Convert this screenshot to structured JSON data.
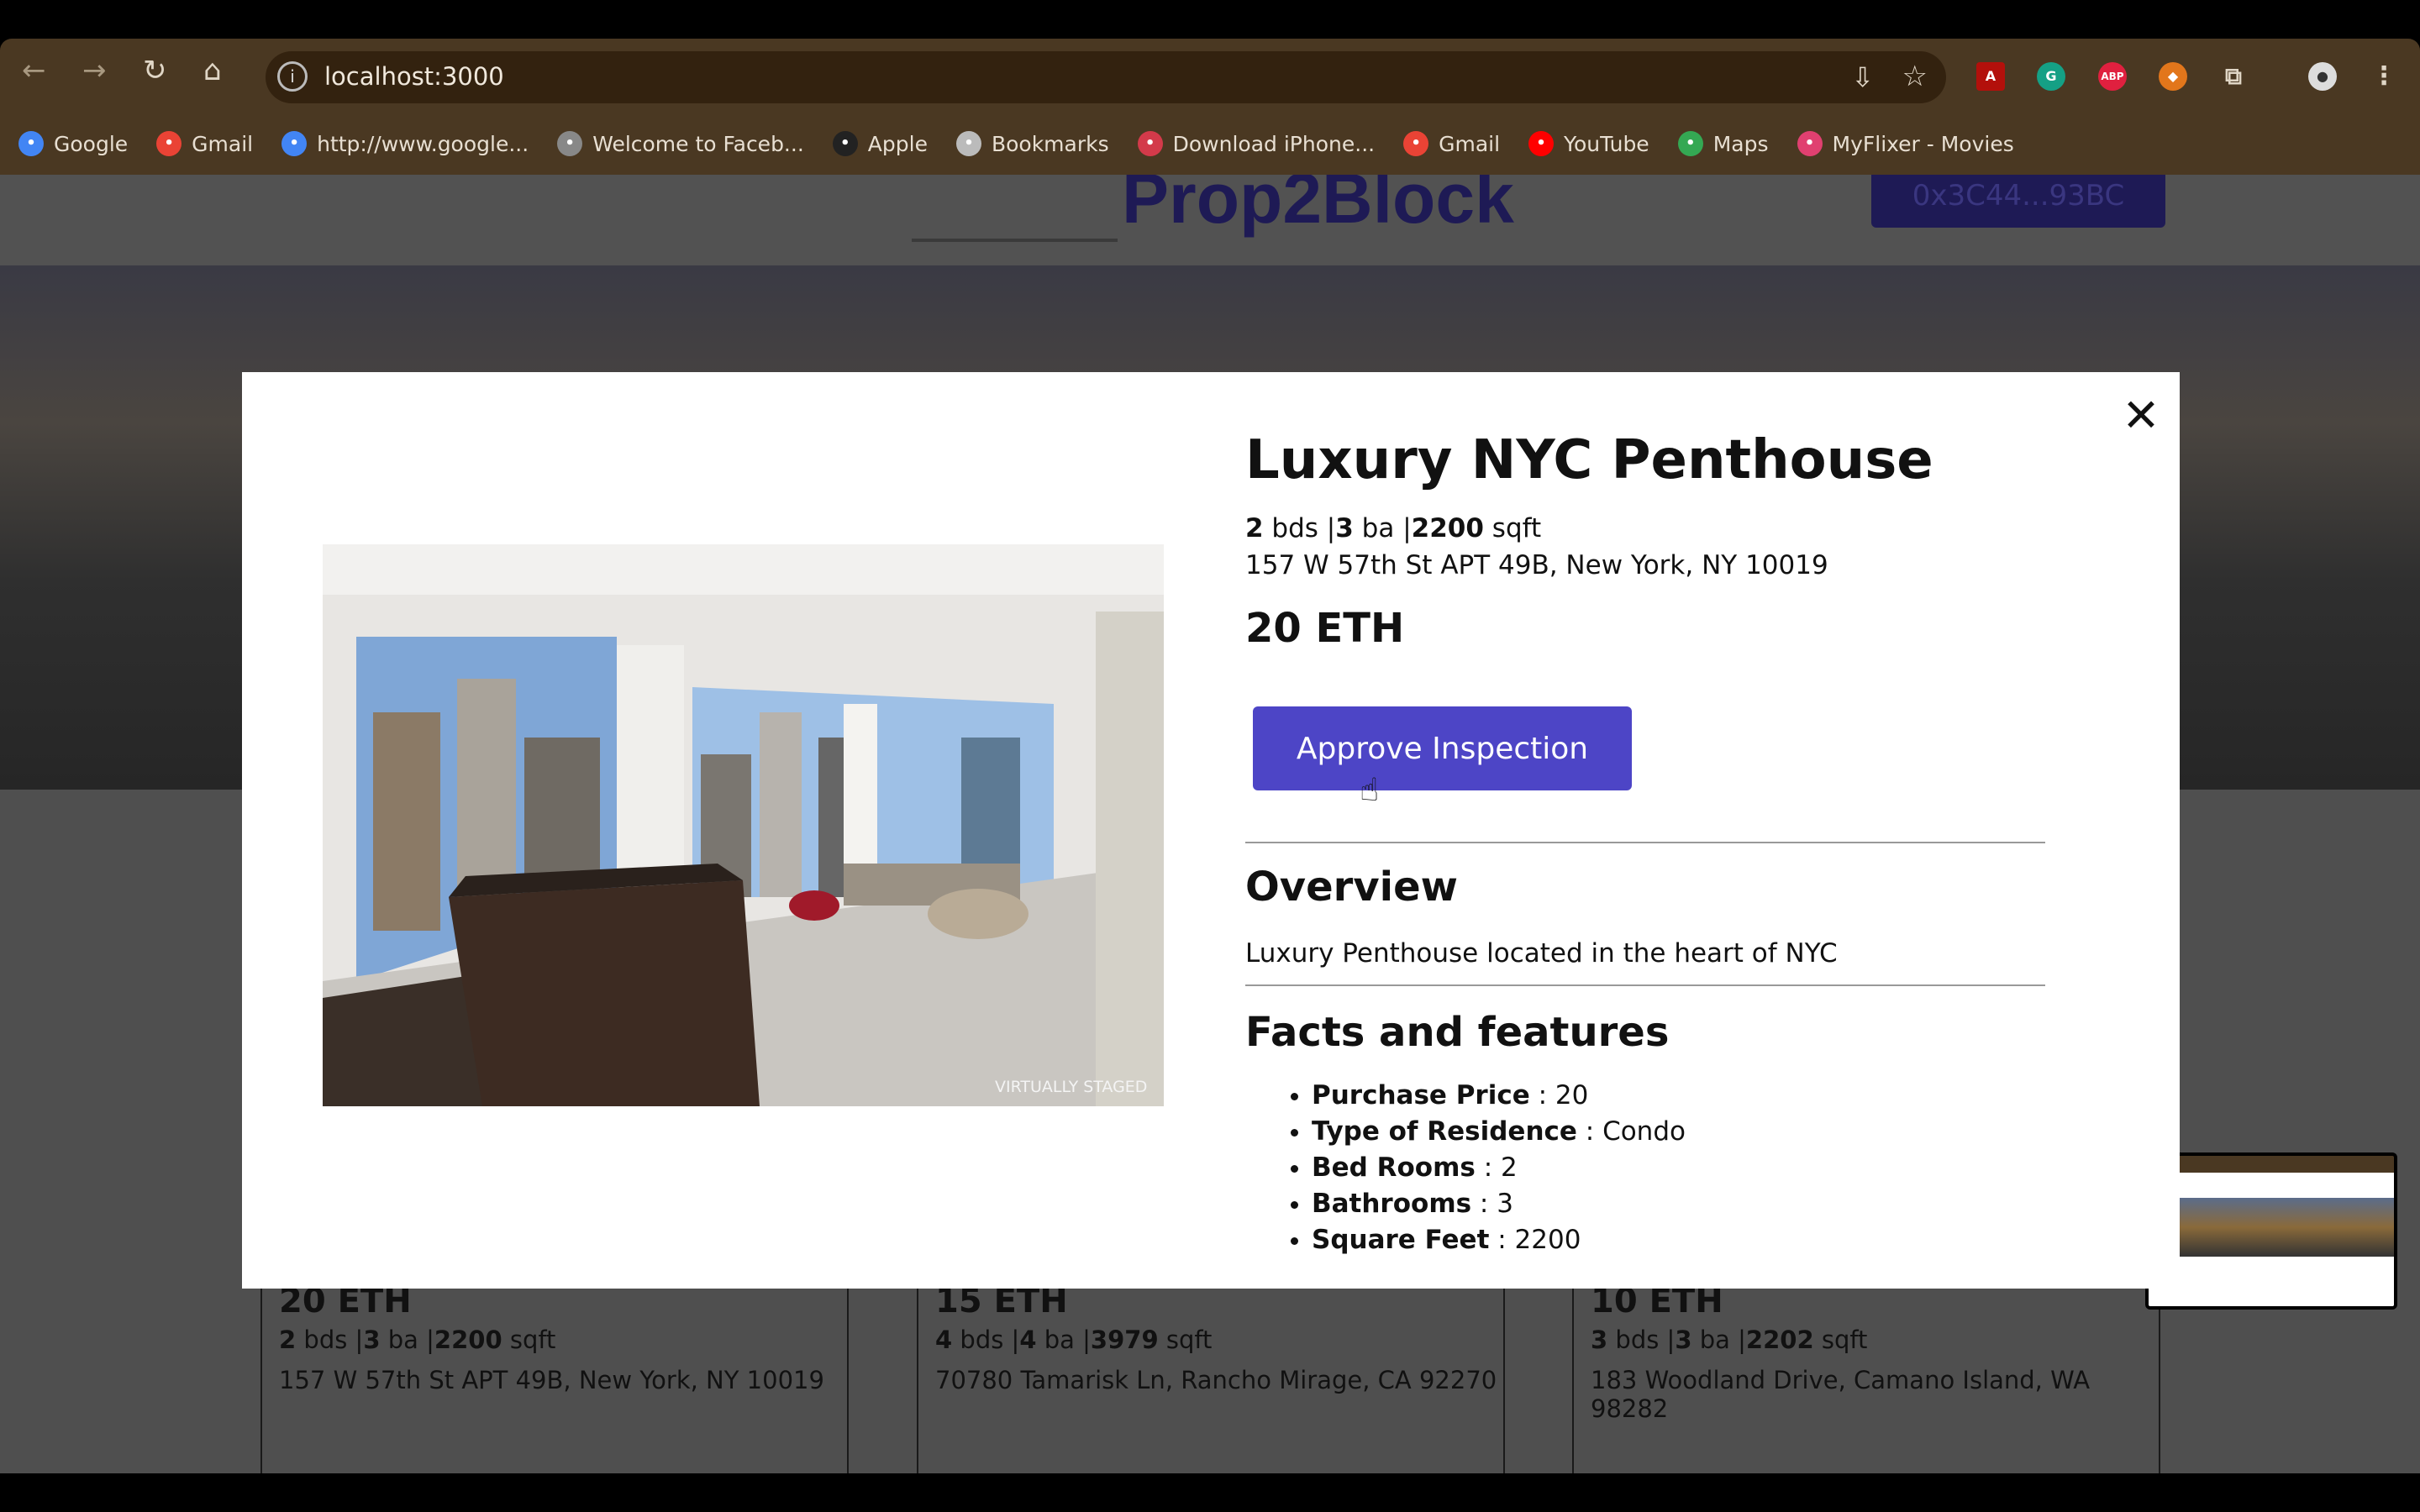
{
  "browser": {
    "url": "localhost:3000",
    "bookmarks": [
      {
        "label": "Google",
        "icon": "google-icon",
        "color": "#4285f4"
      },
      {
        "label": "Gmail",
        "icon": "gmail-icon",
        "color": "#ea4335"
      },
      {
        "label": "http://www.google...",
        "icon": "google-icon",
        "color": "#4285f4"
      },
      {
        "label": "Welcome to Faceb...",
        "icon": "globe-icon",
        "color": "#888888"
      },
      {
        "label": "Apple",
        "icon": "apple-icon",
        "color": "#222222"
      },
      {
        "label": "Bookmarks",
        "icon": "star-icon",
        "color": "#bbbbbb"
      },
      {
        "label": "Download iPhone...",
        "icon": "download-icon",
        "color": "#d33a4a"
      },
      {
        "label": "Gmail",
        "icon": "gmail-icon",
        "color": "#ea4335"
      },
      {
        "label": "YouTube",
        "icon": "youtube-icon",
        "color": "#ff0000"
      },
      {
        "label": "Maps",
        "icon": "maps-icon",
        "color": "#34a853"
      },
      {
        "label": "MyFlixer - Movies",
        "icon": "play-icon",
        "color": "#e04070"
      }
    ]
  },
  "header": {
    "logo": "Prop2Block",
    "wallet": "0x3C44...93BC"
  },
  "cards": [
    {
      "price": "20 ETH",
      "beds": "2",
      "baths": "3",
      "sqft": "2200",
      "address": "157 W 57th St APT 49B, New York, NY 10019"
    },
    {
      "price": "15 ETH",
      "beds": "4",
      "baths": "4",
      "sqft": "3979",
      "address": "70780 Tamarisk Ln, Rancho Mirage, CA 92270"
    },
    {
      "price": "10 ETH",
      "beds": "3",
      "baths": "3",
      "sqft": "2202",
      "address": "183 Woodland Drive, Camano Island, WA 98282"
    }
  ],
  "labels": {
    "bds": " bds |",
    "ba": " ba |",
    "sqft": " sqft"
  },
  "modal": {
    "title": "Luxury NYC Penthouse",
    "beds": "2",
    "baths": "3",
    "sqft": "2200",
    "address": "157 W 57th St APT 49B, New York, NY 10019",
    "price": "20 ETH",
    "photo_caption": "VIRTUALLY STAGED",
    "approve_button": "Approve Inspection",
    "close": "✕",
    "overview_heading": "Overview",
    "description": "Luxury Penthouse located in the heart of NYC",
    "facts_heading": "Facts and features",
    "facts": [
      {
        "label": "Purchase Price",
        "value": " : 20"
      },
      {
        "label": "Type of Residence",
        "value": " : Condo"
      },
      {
        "label": "Bed Rooms",
        "value": " : 2"
      },
      {
        "label": "Bathrooms",
        "value": " : 3"
      },
      {
        "label": "Square Feet",
        "value": " : 2200"
      }
    ]
  },
  "colors": {
    "accent": "#4d45c6",
    "browser_chrome": "#4a3822"
  }
}
